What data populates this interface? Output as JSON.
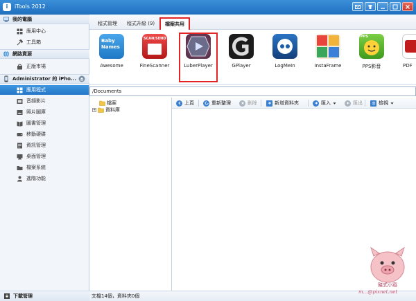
{
  "window": {
    "title": "iTools 2012",
    "app_icon_glyph": "i"
  },
  "sidebar": {
    "section_my_computer": "我的電腦",
    "my_computer_items": [
      {
        "label": "應用中心",
        "icon": "apps-grid-icon"
      },
      {
        "label": "工具箱",
        "icon": "tools-icon"
      }
    ],
    "section_network": "網路資源",
    "network_items": [
      {
        "label": "正版市場",
        "icon": "store-icon"
      }
    ],
    "device_name": "Administrator 的 iPho...",
    "device_items": [
      {
        "label": "應用程式",
        "icon": "apps-grid-icon",
        "selected": true
      },
      {
        "label": "音頻影片",
        "icon": "film-icon"
      },
      {
        "label": "照片圖庫",
        "icon": "photo-icon"
      },
      {
        "label": "圖書管理",
        "icon": "book-icon"
      },
      {
        "label": "移動硬碟",
        "icon": "disk-icon"
      },
      {
        "label": "資訊管理",
        "icon": "info-icon"
      },
      {
        "label": "桌面管理",
        "icon": "desktop-icon"
      },
      {
        "label": "檔案系統",
        "icon": "folder-icon"
      },
      {
        "label": "進階功能",
        "icon": "advanced-icon"
      }
    ],
    "download_label": "下載管理"
  },
  "tabs": [
    {
      "label": "程式管理",
      "active": false
    },
    {
      "label": "程式升級 (9)",
      "active": false
    },
    {
      "label": "檔案共用",
      "active": true
    }
  ],
  "apps": [
    {
      "label": "Awesome",
      "icon_text": "Baby Names",
      "color": "#2f8fd8"
    },
    {
      "label": "FineScanner",
      "icon_text": "SCAN/SEND",
      "color": "#d82a2a"
    },
    {
      "label": "LuberPlayer",
      "icon_text": "",
      "color": "#6b3a5e",
      "highlighted": true
    },
    {
      "label": "GPlayer",
      "icon_text": "",
      "color": "#2a2a2a"
    },
    {
      "label": "LogMeIn",
      "icon_text": "",
      "color": "#1c5fa8"
    },
    {
      "label": "InstaFrame",
      "icon_text": "",
      "color": "#e8463c"
    },
    {
      "label": "PPS影音",
      "icon_text": "PPS",
      "color": "#58b030"
    },
    {
      "label": "PDF",
      "icon_text": "",
      "color": "#c21d1d"
    }
  ],
  "path": "/Documents",
  "tree": [
    {
      "label": "檔案"
    },
    {
      "label": "資料庫"
    }
  ],
  "toolbar": {
    "up": "上頁",
    "refresh": "重新整理",
    "delete": "刪除",
    "new_folder": "新增資料夾",
    "import": "匯入",
    "export": "匯出",
    "view": "檢視"
  },
  "status": "文檔14個，資料夾0個",
  "watermark": {
    "line1": "豬式小窩",
    "line2": "m...@pixnet.net"
  },
  "colors": {
    "accent": "#2477c8",
    "highlight": "#e32424"
  }
}
